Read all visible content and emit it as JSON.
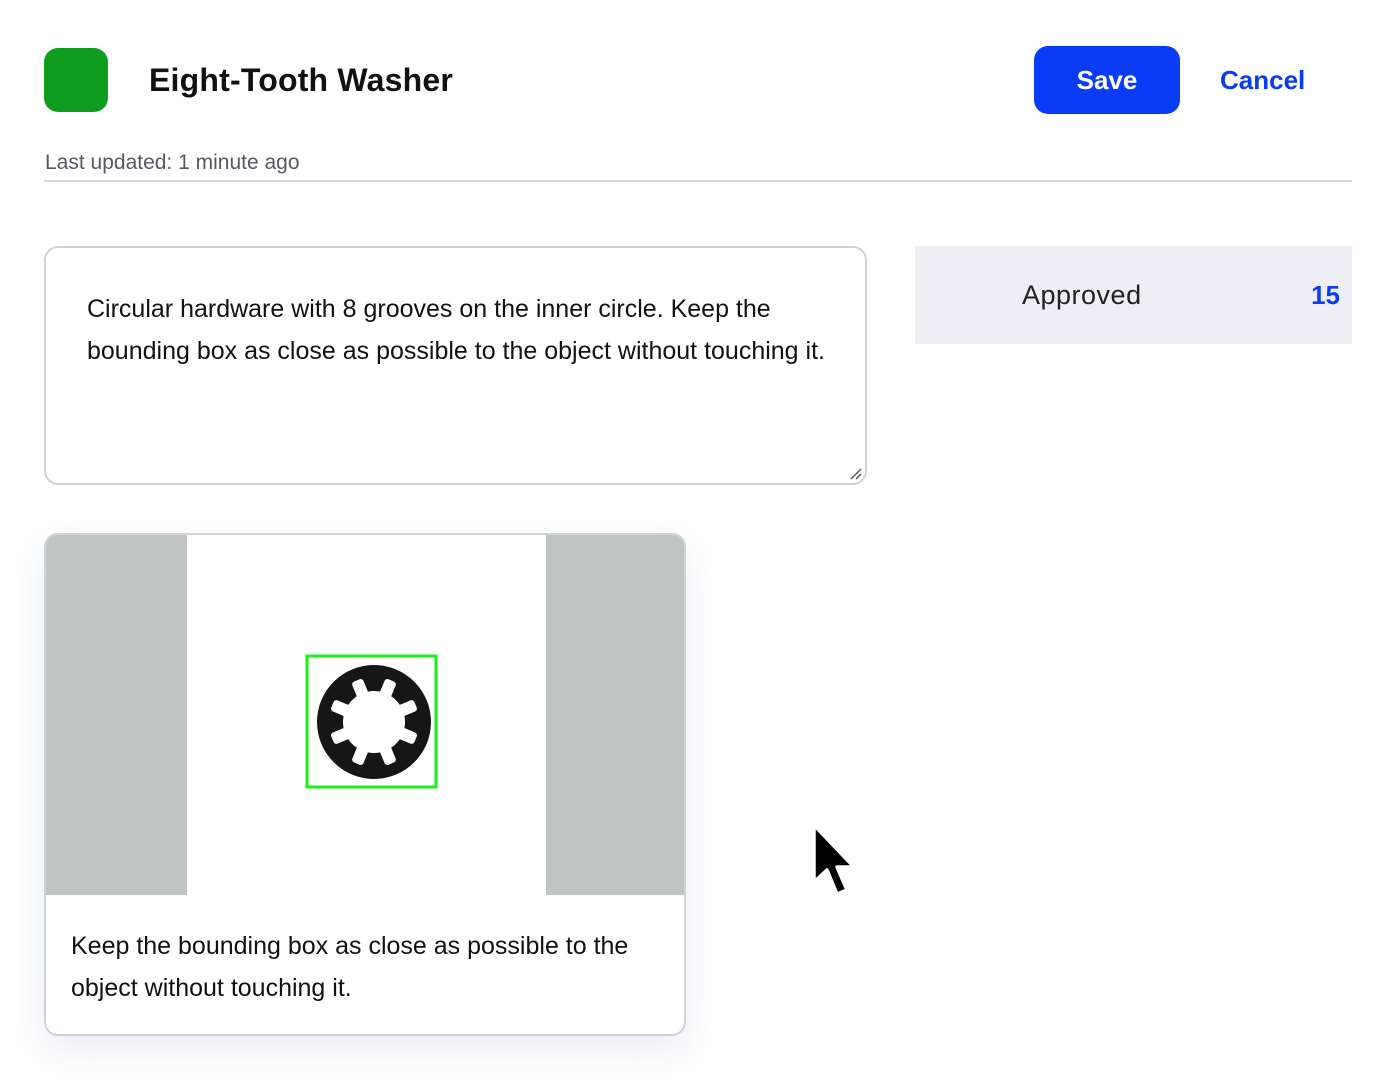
{
  "header": {
    "title": "Eight-Tooth Washer",
    "swatch_color": "#0f9d1f",
    "save_label": "Save",
    "cancel_label": "Cancel",
    "last_updated": "Last updated: 1 minute ago"
  },
  "description": {
    "value": "Circular hardware with 8 grooves on the inner circle. Keep the bounding box as close as possible to the object without touching it."
  },
  "status": {
    "label": "Approved",
    "count": "15"
  },
  "example": {
    "caption": "Keep the bounding box as close as possible to the object without touching it."
  },
  "colors": {
    "primary": "#0a3cf5",
    "bounding_box": "#1bf01b"
  }
}
